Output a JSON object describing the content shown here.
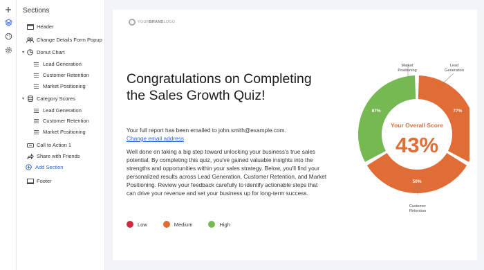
{
  "sidebar": {
    "title": "Sections",
    "items": [
      {
        "label": "Header"
      },
      {
        "label": "Change Details Form Popup"
      },
      {
        "label": "Donut Chart"
      },
      {
        "label": "Lead Generation"
      },
      {
        "label": "Customer Retention"
      },
      {
        "label": "Market Positioning"
      },
      {
        "label": "Category Scores"
      },
      {
        "label": "Lead Generation"
      },
      {
        "label": "Customer Retention"
      },
      {
        "label": "Market Positioning"
      },
      {
        "label": "Call to Action 1"
      },
      {
        "label": "Share with Friends"
      },
      {
        "label": "Add Section"
      },
      {
        "label": "Footer"
      }
    ]
  },
  "rail": {
    "icons": [
      "plus-icon",
      "layers-icon",
      "palette-icon",
      "gear-icon"
    ]
  },
  "page": {
    "logo_text_a": "YOUR",
    "logo_text_b": "BRAND",
    "logo_text_c": "LOGO",
    "headline": "Congratulations on Completing the Sales Growth Quiz!",
    "emailed": "Your full report has been emailed to john.smith@example.com.",
    "change_email": "Change email address",
    "body": "Well done on taking a big step toward unlocking your business's true sales potential. By completing this quiz, you've gained valuable insights into the strengths and opportunities within your sales strategy. Below, you'll find your personalized results across Lead Generation, Customer Retention, and Market Positioning. Review your feedback carefully to identify actionable steps that can drive your revenue and set your business up for long-term success.",
    "legend": [
      {
        "label": "Low",
        "color": "#d02b3a"
      },
      {
        "label": "Medium",
        "color": "#e06c36"
      },
      {
        "label": "High",
        "color": "#76b852"
      }
    ]
  },
  "chart_data": {
    "type": "pie",
    "center_title": "Your Overall Score",
    "center_value": "43%",
    "center_color": "#e06c36",
    "slices": [
      {
        "name": "Lead Generation",
        "value": 77,
        "label": "77%",
        "color": "#e06c36"
      },
      {
        "name": "Customer Retention",
        "value": 50,
        "label": "50%",
        "color": "#e06c36"
      },
      {
        "name": "Market Positioning",
        "value": 87,
        "label": "87%",
        "color": "#76b852"
      }
    ],
    "callouts": {
      "lead": [
        "Lead",
        "Generation"
      ],
      "retention": [
        "Customer",
        "Retention"
      ],
      "market": [
        "Market",
        "Positioning"
      ]
    }
  }
}
